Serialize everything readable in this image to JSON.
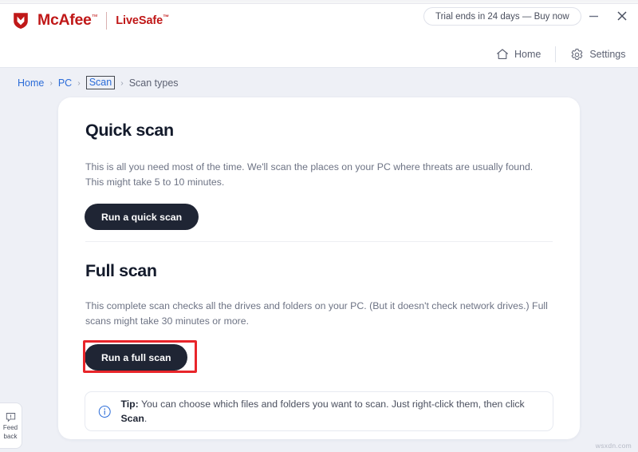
{
  "window": {
    "brand_name": "McAfee",
    "brand_tm": "™",
    "product_name": "LiveSafe",
    "product_sup": "™",
    "trial_badge": "Trial ends in 24 days — Buy now",
    "minimize_label": "—",
    "close_label": "✕",
    "accent_red": "#c01818",
    "annotation_red": "#e8252a"
  },
  "header_nav": {
    "items": [
      {
        "label": "Home",
        "icon": "home-icon"
      },
      {
        "label": "Settings",
        "icon": "gear-icon"
      }
    ]
  },
  "breadcrumb": {
    "items": [
      {
        "label": "Home",
        "type": "link"
      },
      {
        "label": "PC",
        "type": "link"
      },
      {
        "label": "Scan",
        "type": "focused-link"
      },
      {
        "label": "Scan types",
        "type": "current"
      }
    ],
    "separator": "›"
  },
  "main": {
    "sections": [
      {
        "title": "Quick scan",
        "description": "This is all you need most of the time. We'll scan the places on your PC where threats are usually found. This might take 5 to 10 minutes.",
        "button_label": "Run a quick scan"
      },
      {
        "title": "Full scan",
        "description": "This complete scan checks all the drives and folders on your PC. (But it doesn't check network drives.) Full scans might take 30 minutes or more.",
        "button_label": "Run a full scan"
      }
    ],
    "tip": {
      "icon": "info-icon",
      "label": "Tip:",
      "text_before": " You can choose which files and folders you want to scan. Just right-click them, then click ",
      "emphasis": "Scan",
      "text_after": "."
    }
  },
  "feedback": {
    "icon": "feedback-bubble-icon",
    "line1": "Feed",
    "line2": "back"
  },
  "watermark": "wsxdn.com"
}
